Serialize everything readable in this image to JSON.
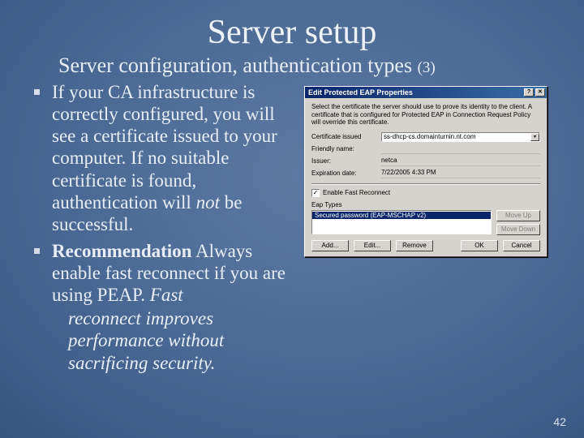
{
  "title": "Server setup",
  "subtitle_main": "Server configuration, authentication types ",
  "subtitle_part": "(3)",
  "bullets": [
    {
      "text_a": "If your CA infrastructure is correctly configured, you will see a certificate issued to your computer. If no suitable certificate is found, authentication will ",
      "ital_a": "not",
      "text_b": " be successful."
    },
    {
      "bold_a": "Recommendation",
      "text_a": " Always enable fast reconnect if you are using PEAP. ",
      "ital_a": "Fast"
    }
  ],
  "trailing_lines": "reconnect improves performance without sacrificing security.",
  "dialog": {
    "title": "Edit Protected EAP Properties",
    "description": "Select the certificate the server should use to prove its identity to the client. A certificate that is configured for Protected EAP in Connection Request Policy will override this certificate.",
    "labels": {
      "cert_issued": "Certificate issued",
      "friendly": "Friendly name:",
      "issuer": "Issuer:",
      "expiration": "Expiration date:",
      "eap_types": "Eap Types"
    },
    "values": {
      "cert_issued": "ss-dhcp-cs.domainturnin.nt.com",
      "friendly": "",
      "issuer": "netca",
      "expiration": "7/22/2005 4:33 PM"
    },
    "checkbox_label": "Enable Fast Reconnect",
    "checkbox_checked": "✓",
    "listbox_selected": "Secured password (EAP-MSCHAP v2)",
    "buttons": {
      "move_up": "Move Up",
      "move_down": "Move Down",
      "add": "Add...",
      "edit": "Edit...",
      "remove": "Remove",
      "ok": "OK",
      "cancel": "Cancel",
      "help": "?",
      "close": "✕"
    }
  },
  "page_number": "42"
}
